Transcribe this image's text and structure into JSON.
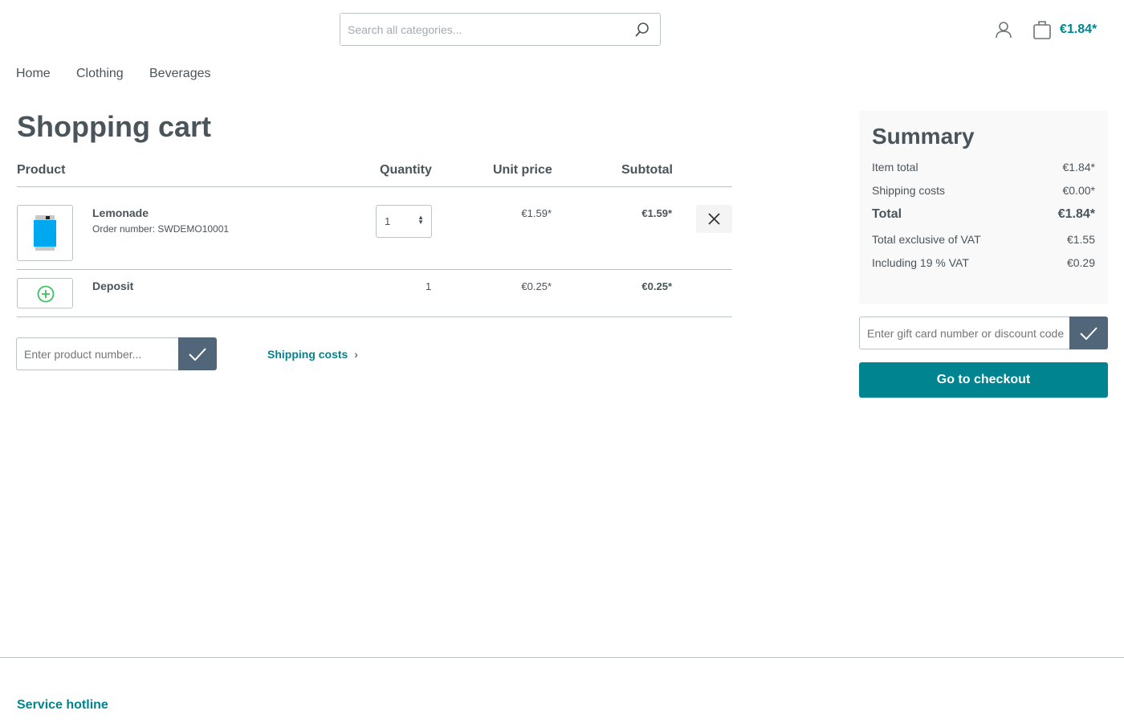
{
  "header": {
    "search_placeholder": "Search all categories...",
    "cart_total": "€1.84*"
  },
  "nav": [
    "Home",
    "Clothing",
    "Beverages"
  ],
  "page_title": "Shopping cart",
  "table": {
    "headers": [
      "Product",
      "Quantity",
      "Unit price",
      "Subtotal"
    ],
    "items": [
      {
        "name": "Lemonade",
        "order_number": "Order number: SWDEMO10001",
        "quantity": "1",
        "unit_price": "€1.59*",
        "subtotal": "€1.59*"
      },
      {
        "name": "Deposit",
        "quantity": "1",
        "unit_price": "€0.25*",
        "subtotal": "€0.25*"
      }
    ]
  },
  "add_product": {
    "placeholder": "Enter product number..."
  },
  "shipping_costs_link": "Shipping costs",
  "summary": {
    "title": "Summary",
    "rows": [
      {
        "label": "Item total",
        "value": "€1.84*"
      },
      {
        "label": "Shipping costs",
        "value": "€0.00*"
      },
      {
        "label": "Total",
        "value": "€1.84*"
      },
      {
        "label": "Total exclusive of VAT",
        "value": "€1.55"
      },
      {
        "label": "Including 19 % VAT",
        "value": "€0.29"
      }
    ]
  },
  "voucher": {
    "placeholder": "Enter gift card number or discount code"
  },
  "checkout_label": "Go to checkout",
  "footer": {
    "service_hotline": "Service hotline"
  },
  "colors": {
    "accent": "#008490",
    "check_button": "#52667a",
    "deposit_icon": "#3cc261"
  }
}
